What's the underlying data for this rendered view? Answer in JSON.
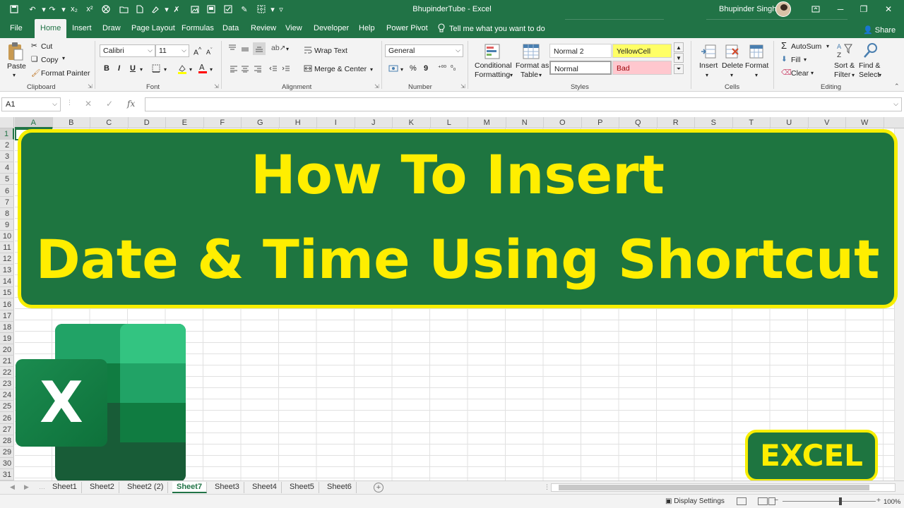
{
  "window": {
    "title": "BhupinderTube  -  Excel",
    "user": "Bhupinder Singh",
    "theme_color": "#217346"
  },
  "ribbon_tabs": [
    "File",
    "Home",
    "Insert",
    "Draw",
    "Page Layout",
    "Formulas",
    "Data",
    "Review",
    "View",
    "Developer",
    "Help",
    "Power Pivot"
  ],
  "active_tab": "Home",
  "tell_me": "Tell me what you want to do",
  "share": "Share",
  "clipboard": {
    "paste": "Paste",
    "cut": "Cut",
    "copy": "Copy",
    "format_painter": "Format Painter",
    "label": "Clipboard"
  },
  "font": {
    "name": "Calibri",
    "size": "11",
    "bold": "B",
    "italic": "I",
    "underline": "U",
    "label": "Font"
  },
  "alignment": {
    "wrap_text": "Wrap Text",
    "merge_center": "Merge & Center",
    "label": "Alignment"
  },
  "number": {
    "format": "General",
    "percent": "%",
    "comma": "9",
    "label": "Number"
  },
  "styles": {
    "conditional_formatting": [
      "Conditional",
      "Formatting"
    ],
    "format_as_table": [
      "Format as",
      "Table"
    ],
    "normal2": "Normal 2",
    "yellowcell": "YellowCell",
    "normal": "Normal",
    "bad": "Bad",
    "label": "Styles"
  },
  "cells": {
    "insert": "Insert",
    "delete": "Delete",
    "format": "Format",
    "label": "Cells"
  },
  "editing": {
    "autosum": "AutoSum",
    "fill": "Fill",
    "clear": "Clear",
    "sort_filter": [
      "Sort &",
      "Filter"
    ],
    "find_select": [
      "Find &",
      "Select"
    ],
    "label": "Editing"
  },
  "formula_bar": {
    "name_box": "A1",
    "fx": "fx",
    "cancel": "✕",
    "enter": "✓",
    "content": ""
  },
  "columns": [
    "A",
    "B",
    "C",
    "D",
    "E",
    "F",
    "G",
    "H",
    "I",
    "J",
    "K",
    "L",
    "M",
    "N",
    "O",
    "P",
    "Q",
    "R",
    "S",
    "T",
    "U",
    "V",
    "W"
  ],
  "rows": [
    "1",
    "2",
    "3",
    "4",
    "5",
    "6",
    "7",
    "8",
    "9",
    "10",
    "11",
    "12",
    "13",
    "14",
    "15",
    "16",
    "17",
    "18",
    "19",
    "20",
    "21",
    "22",
    "23",
    "24",
    "25",
    "26",
    "27",
    "28",
    "29",
    "30",
    "31"
  ],
  "banner": {
    "line1": "How To Insert",
    "line2": "Date & Time Using Shortcut",
    "bg_color": "#1e7540",
    "text_color": "#ffee00"
  },
  "logo_letter": "X",
  "badge": "EXCEL",
  "sheets": [
    "Sheet1",
    "Sheet2",
    "Sheet2 (2)",
    "Sheet7",
    "Sheet3",
    "Sheet4",
    "Sheet5",
    "Sheet6"
  ],
  "active_sheet": "Sheet7",
  "status": {
    "display_settings": "Display Settings",
    "zoom": "100%"
  }
}
